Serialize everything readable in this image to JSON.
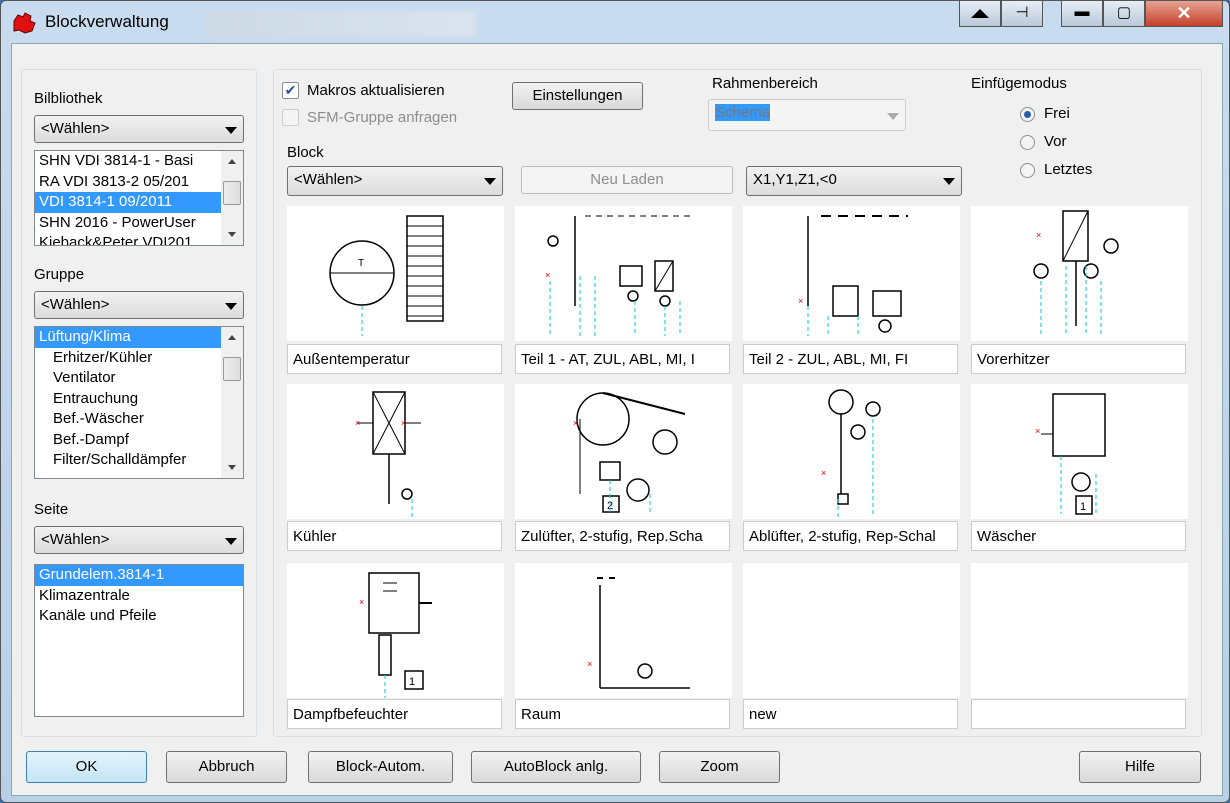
{
  "window": {
    "title": "Blockverwaltung"
  },
  "left": {
    "bibliothek": {
      "label": "Bilbliothek",
      "combo": "<Wählen>",
      "items": [
        "SHN VDI 3814-1 - Basi",
        "RA VDI 3813-2 05/201",
        "VDI 3814-1 09/2011",
        "SHN 2016 - PowerUser",
        "Kieback&Peter VDI201"
      ],
      "selected": 2
    },
    "gruppe": {
      "label": "Gruppe",
      "combo": "<Wählen>",
      "items": [
        "Lüftung/Klima",
        "Erhitzer/Kühler",
        "Ventilator",
        "Entrauchung",
        "Bef.-Wäscher",
        "Bef.-Dampf",
        "Filter/Schalldämpfer"
      ],
      "selected": 0
    },
    "seite": {
      "label": "Seite",
      "combo": "<Wählen>",
      "items": [
        "Grundelem.3814-1",
        "Klimazentrale",
        "Kanäle und Pfeile"
      ],
      "selected": 0
    }
  },
  "options": {
    "makros": {
      "label": "Makros aktualisieren",
      "checked": true
    },
    "sfm": {
      "label": "SFM-Gruppe anfragen",
      "checked": false,
      "disabled": true
    },
    "einstellungen": "Einstellungen",
    "rahmen": {
      "label": "Rahmenbereich",
      "value": "Schema"
    },
    "einfuege": {
      "label": "Einfügemodus",
      "options": [
        "Frei",
        "Vor",
        "Letztes"
      ],
      "selected": 0
    },
    "block": {
      "label": "Block",
      "combo": "<Wählen>"
    },
    "neu_laden": "Neu Laden",
    "coords": "X1,Y1,Z1,<0"
  },
  "tiles": [
    "Außentemperatur",
    "Teil 1 - AT, ZUL, ABL, MI, I",
    "Teil 2 -  ZUL, ABL, MI, FI",
    "Vorerhitzer",
    "Kühler",
    "Zulüfter, 2-stufig, Rep.Scha",
    "Ablüfter, 2-stufig, Rep-Schal",
    "Wäscher",
    "Dampfbefeuchter",
    "Raum",
    "new",
    ""
  ],
  "buttons": {
    "ok": "OK",
    "abbruch": "Abbruch",
    "block_autom": "Block-Autom.",
    "autoblock": "AutoBlock anlg.",
    "zoom": "Zoom",
    "hilfe": "Hilfe"
  },
  "colors": {
    "selection": "#3399ff",
    "line": "#00c8e6",
    "marker": "#e00000"
  }
}
